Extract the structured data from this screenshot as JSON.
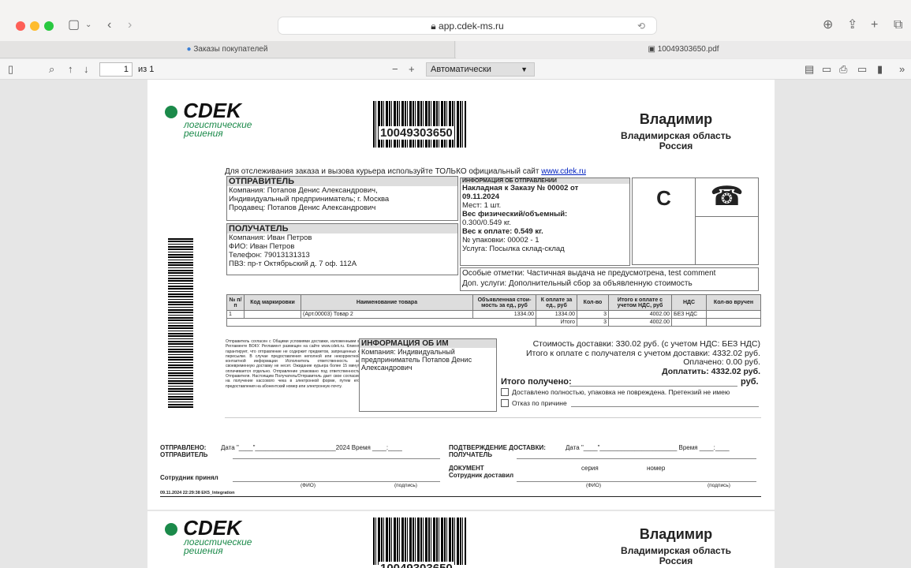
{
  "browser": {
    "url": "app.cdek-ms.ru",
    "tabs": [
      "Заказы покупателей",
      "10049303650.pdf"
    ]
  },
  "pdf_toolbar": {
    "page": "1",
    "of": "из 1",
    "zoom": "Автоматически"
  },
  "doc": {
    "brand": "CDEK",
    "tagline1": "логистические",
    "tagline2": "решения",
    "barcode": "10049303650",
    "city": "Владимир",
    "region": "Владимирская область",
    "country": "Россия",
    "track_text": "Для отслеживания заказа и вызова курьера используйте ТОЛЬКО официальный сайт",
    "track_link": "www.cdek.ru",
    "sender_title": "ОТПРАВИТЕЛЬ",
    "sender_company": "Компания: Потапов Денис Александрович,",
    "sender_company2": "Индивидуальный предприниматель; г. Москва",
    "sender_seller": "Продавец: Потапов Денис Александрович",
    "recipient_title": "ПОЛУЧАТЕЛЬ",
    "recipient_company": "Компания: Иван Петров",
    "recipient_name": "ФИО: Иван Петров",
    "recipient_phone": "Телефон: 79013131313",
    "recipient_pvz": "ПВЗ: пр-т Октябрьский д. 7 оф. 112А",
    "ship_title": "ИНФОРМАЦИЯ ОБ ОТПРАВЛЕНИИ",
    "ship_invoice": "Накладная к Заказу № 00002 от",
    "ship_date": "09.11.2024",
    "ship_places": "Мест: 1 шт.",
    "ship_weight": "Вес физический/объемный:",
    "ship_weight_val": "0.300/0.549 кг.",
    "ship_pay_weight": "Вес к оплате: 0.549 кг.",
    "ship_pack": "№ упаковки: 00002 - 1",
    "ship_service": "Услуга: Посылка склад-склад",
    "code_letter": "С",
    "special": "Особые отметки:  Частичная выдача не предусмотрена, test comment",
    "extra": "Доп. услуги: Дополнительный сбор за объявленную стоимость",
    "table_headers": [
      "№ п/п",
      "Код маркировки",
      "Наименование товара",
      "Объявленная стои-мость за ед., руб",
      "К оплате за ед., руб",
      "Кол-во",
      "Итого к оплате с учетом НДС, руб",
      "НДС",
      "Кол-во вручен"
    ],
    "table_row": [
      "1",
      "",
      "(Арт.00003) Товар 2",
      "1334.00",
      "1334.00",
      "3",
      "4002.00",
      "БЕЗ НДС",
      ""
    ],
    "total_label": "Итого",
    "total_qty": "3",
    "total_sum": "4002.00",
    "agreement": "Отправитель согласен с Общими условиями доставки, изложенными в Регламенте ВОКУ. Регламент размещен на сайте www.cdek.ru. Клиент гарантирует, что отправление не содержит предметов, запрещенных к пересылке. В случае предоставления неполной или некорректной контактной информации Исполнитель ответственность за своевременную доставку не несет. Ожидание курьера более 15 минут оплачивается отдельно. Отправление упаковано под ответственность Отправителя. Настоящим Получатель/Отправитель дает свое согласие на получение кассового чека в электронной форме, путем его предоставления на абонентский номер или электронную почту.",
    "im_title": "ИНФОРМАЦИЯ ОБ ИМ",
    "im_text1": "Компания: Индивидуальный",
    "im_text2": "предприниматель Потапов Денис",
    "im_text3": "Александрович",
    "cost_delivery": "Стоимость доставки: 330.02 руб. (с учетом НДС: БЕЗ НДС)",
    "cost_total": "Итого к оплате с получателя с учетом доставки: 4332.02 руб.",
    "cost_paid": "Оплачено: 0.00 руб.",
    "cost_topay": "Доплатить: 4332.02 руб.",
    "received": "Итого получено:",
    "received_unit": "руб.",
    "check1": "Доставлено полностью, упаковка не повреждена. Претензий не имею",
    "check2": "Отказ по причине",
    "sent_label1": "ОТПРАВЛЕНО:",
    "sent_label2": "ОТПРАВИТЕЛЬ",
    "sent_date": "Дата \"____\"_______________________2024 Время ____:____",
    "confirm1": "ПОДТВЕРЖДЕНИЕ ДОСТАВКИ:",
    "confirm2": "ПОЛУЧАТЕЛЬ",
    "confirm_date": "Дата \"____\"______________________ Время ____:____",
    "doc_label": "ДОКУМЕНТ",
    "series": "серия",
    "number": "номер",
    "employee_accepted": "Сотрудник принял",
    "employee_delivered": "Сотрудник доставил",
    "fio": "(ФИО)",
    "sign": "(подпись)",
    "footer": "09.11.2024 22:29:38 EK5_Integration"
  }
}
